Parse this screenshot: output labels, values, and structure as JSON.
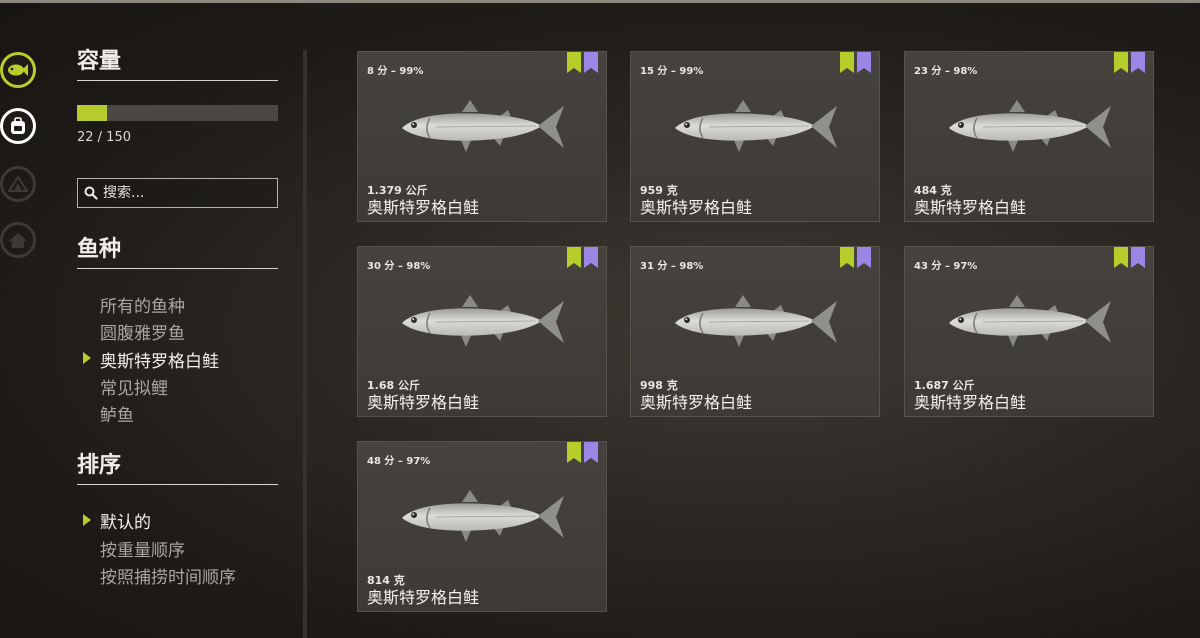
{
  "sidebar": {
    "icons": [
      "fish-icon",
      "backpack-icon",
      "camp-icon",
      "home-icon"
    ]
  },
  "capacity": {
    "title": "容量",
    "used": 22,
    "total": 150,
    "text": "22 / 150",
    "fill_fraction": 0.147
  },
  "search": {
    "placeholder": "搜索..."
  },
  "species": {
    "title": "鱼种",
    "items": [
      {
        "label": "所有的鱼种"
      },
      {
        "label": "圆腹雅罗鱼"
      },
      {
        "label": "奥斯特罗格白鲑",
        "selected": true
      },
      {
        "label": "常见拟鲤"
      },
      {
        "label": "鲈鱼"
      }
    ]
  },
  "sort": {
    "title": "排序",
    "items": [
      {
        "label": "默认的",
        "selected": true
      },
      {
        "label": "按重量顺序"
      },
      {
        "label": "按照捕捞时间顺序"
      }
    ]
  },
  "colors": {
    "accent_green": "#b5ce2c",
    "badge_purple": "#9b86e6"
  },
  "fish_cards": [
    {
      "score": "8 分 – 99%",
      "weight": "1.379 公斤",
      "name": "奥斯特罗格白鲑"
    },
    {
      "score": "15 分 – 99%",
      "weight": "959 克",
      "name": "奥斯特罗格白鲑"
    },
    {
      "score": "23 分 – 98%",
      "weight": "484 克",
      "name": "奥斯特罗格白鲑"
    },
    {
      "score": "30 分 – 98%",
      "weight": "1.68 公斤",
      "name": "奥斯特罗格白鲑"
    },
    {
      "score": "31 分 – 98%",
      "weight": "998 克",
      "name": "奥斯特罗格白鲑"
    },
    {
      "score": "43 分 – 97%",
      "weight": "1.687 公斤",
      "name": "奥斯特罗格白鲑"
    },
    {
      "score": "48 分 – 97%",
      "weight": "814 克",
      "name": "奥斯特罗格白鲑"
    }
  ]
}
